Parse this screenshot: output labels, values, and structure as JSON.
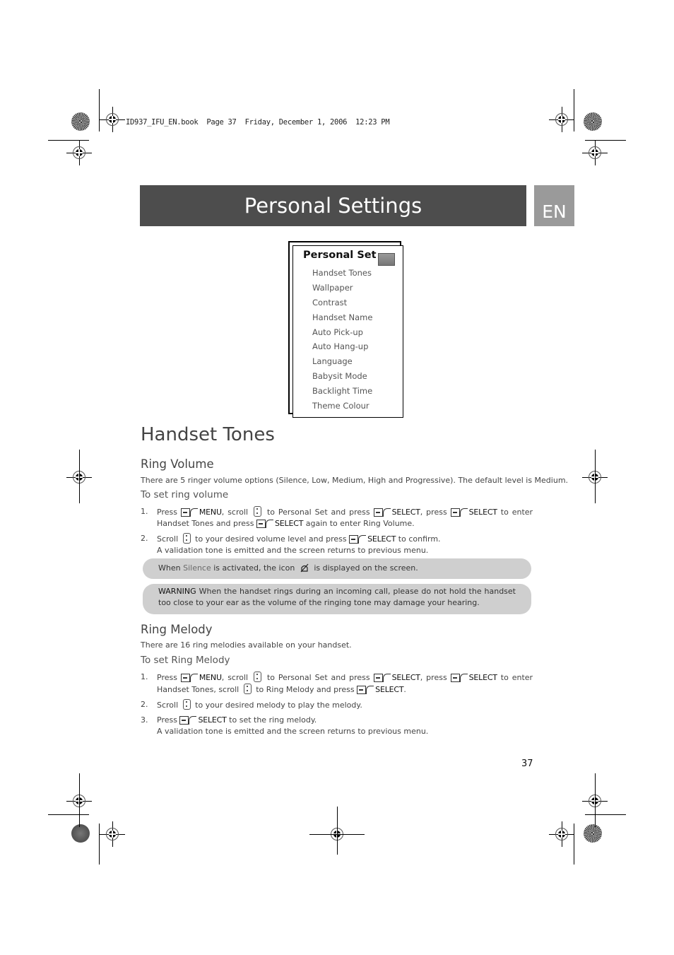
{
  "print_header": "ID937_IFU_EN.book  Page 37  Friday, December 1, 2006  12:23 PM",
  "title_bar": {
    "title": "Personal Settings",
    "language_tab": "EN"
  },
  "menu_screen": {
    "title": "Personal Set",
    "icon": "personal-settings-icon",
    "items": [
      "Handset Tones",
      "Wallpaper",
      "Contrast",
      "Handset Name",
      "Auto Pick-up",
      "Auto Hang-up",
      "Language",
      "Babysit Mode",
      "Backlight Time",
      "Theme Colour"
    ]
  },
  "section_title": "Handset Tones",
  "ring_volume": {
    "heading": "Ring Volume",
    "intro": "There are 5 ringer volume options (Silence, Low, Medium, High and Progressive). The default level is Medium.",
    "procedure_title": "To set ring volume",
    "steps": [
      {
        "num": "1.",
        "parts": [
          "Press",
          "MENU",
          ", scroll",
          "to Personal Set and press",
          "SELECT",
          ", press",
          "SELECT",
          "to enter Handset Tones and press",
          "SELECT",
          "again to enter Ring Volume."
        ]
      },
      {
        "num": "2.",
        "parts": [
          "Scroll",
          "to your desired volume level and press",
          "SELECT",
          "to confirm.",
          "A validation tone is emitted and the screen returns to previous menu."
        ]
      }
    ],
    "note": {
      "prefix": "When",
      "highlight": "Silence",
      "middle": "is activated, the icon",
      "suffix": "is displayed on the screen.",
      "icon": "silent-bell-icon"
    },
    "warning": {
      "label": "WARNING",
      "text": "When the handset rings during an incoming call, please do not hold the handset too close to your ear as the volume of the ringing tone may damage your hearing."
    }
  },
  "ring_melody": {
    "heading": "Ring Melody",
    "intro": "There are 16 ring melodies available on your handset.",
    "procedure_title": "To set Ring Melody",
    "steps": [
      {
        "num": "1.",
        "parts": [
          "Press",
          "MENU",
          ", scroll",
          "to Personal Set and press",
          "SELECT",
          ", press",
          "SELECT",
          "to enter Handset Tones, scroll",
          "to Ring Melody and press",
          "SELECT",
          "."
        ]
      },
      {
        "num": "2.",
        "parts": [
          "Scroll",
          "to your desired melody to play the melody."
        ]
      },
      {
        "num": "3.",
        "parts": [
          "Press",
          "SELECT",
          "to set the ring melody.",
          "A validation tone is emitted and the screen returns to previous menu."
        ]
      }
    ]
  },
  "page_number": "37"
}
